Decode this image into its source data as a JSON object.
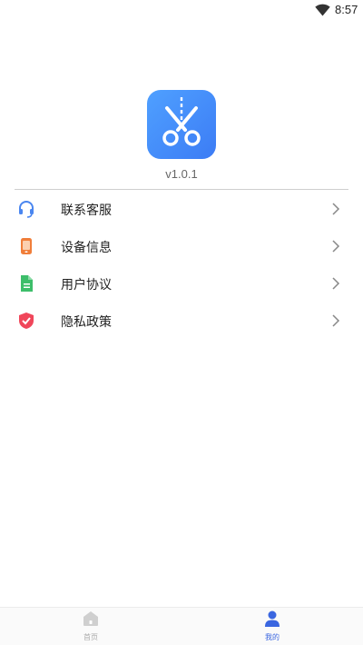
{
  "status_bar": {
    "time": "8:57",
    "wifi_icon": "wifi-icon"
  },
  "app": {
    "logo_icon": "scissors-icon",
    "logo_color": "#3F84F8",
    "version": "v1.0.1"
  },
  "menu": {
    "items": [
      {
        "label": "联系客服",
        "icon": "headset-icon",
        "icon_color": "#4A86F0"
      },
      {
        "label": "设备信息",
        "icon": "phone-icon",
        "icon_color": "#F07E3A"
      },
      {
        "label": "用户协议",
        "icon": "document-icon",
        "icon_color": "#3DBE6A"
      },
      {
        "label": "隐私政策",
        "icon": "shield-icon",
        "icon_color": "#F0465A"
      }
    ]
  },
  "tab_bar": {
    "tabs": [
      {
        "label": "首页",
        "icon": "home-icon",
        "active": false
      },
      {
        "label": "我的",
        "icon": "user-icon",
        "active": true
      }
    ],
    "active_color": "#3A66E0",
    "inactive_color": "#AAAAAA"
  }
}
